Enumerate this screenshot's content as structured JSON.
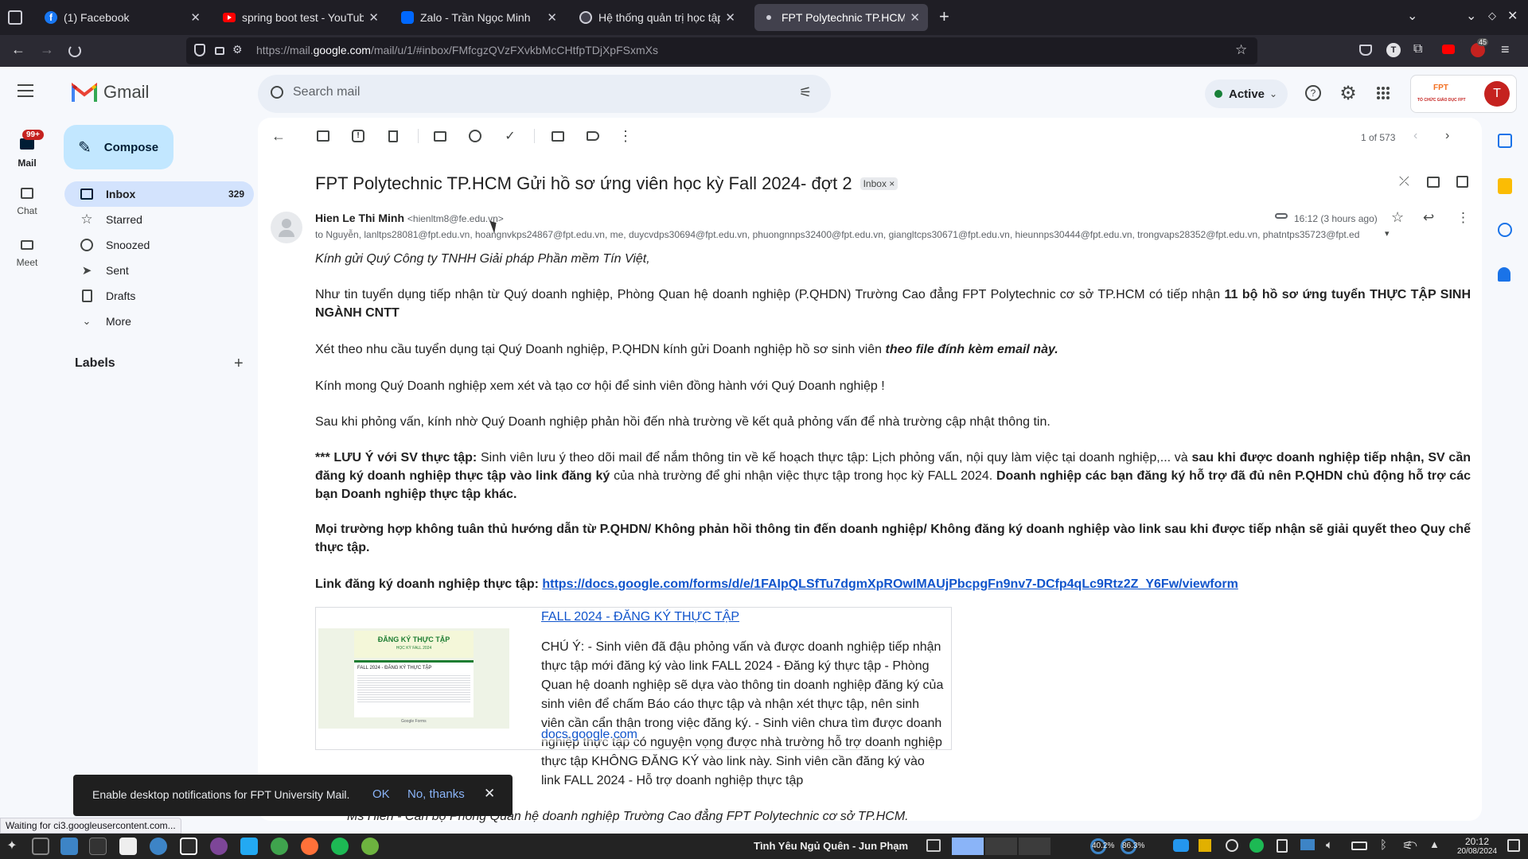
{
  "browser": {
    "tabs": [
      {
        "title": "(1) Facebook",
        "icon": "facebook-icon",
        "color": "#1877f2"
      },
      {
        "title": "spring boot test - YouTube",
        "icon": "youtube-icon",
        "color": "#ff0000"
      },
      {
        "title": "Zalo - Trần Ngọc Minh",
        "icon": "zalo-icon",
        "color": "#0068ff"
      },
      {
        "title": "Hệ thống quản trị học tập",
        "icon": "lms-icon",
        "color": "#f37021"
      },
      {
        "title": "FPT Polytechnic TP.HCM Gửi",
        "icon": "gmail-icon",
        "color": "#ea4335"
      }
    ],
    "url_prefix": "https://mail.",
    "url_domain": "google.com",
    "url_rest": "/mail/u/1/#inbox/FMfcgzQVzFXvkbMcCHtfpTDjXpFSxmXs",
    "ext_badge": "45"
  },
  "gmail": {
    "logo_text": "Gmail",
    "search_placeholder": "Search mail",
    "status_label": "Active",
    "account_initial": "T",
    "org_logo_text": "TỔ CHỨC GIÁO DỤC FPT",
    "rail": [
      {
        "label": "Mail",
        "badge": "99+"
      },
      {
        "label": "Chat"
      },
      {
        "label": "Meet"
      }
    ],
    "compose_label": "Compose",
    "nav": [
      {
        "label": "Inbox",
        "count": "329"
      },
      {
        "label": "Starred"
      },
      {
        "label": "Snoozed"
      },
      {
        "label": "Sent"
      },
      {
        "label": "Drafts"
      },
      {
        "label": "More"
      }
    ],
    "labels_heading": "Labels",
    "pagination": "1 of 573"
  },
  "email": {
    "subject": "FPT Polytechnic TP.HCM Gửi hồ sơ ứng viên học kỳ Fall 2024- đợt 2",
    "inbox_chip": "Inbox",
    "sender_name": "Hien Le Thi Minh",
    "sender_email": "<hienltm8@fe.edu.vn>",
    "time": "16:12 (3 hours ago)",
    "recipients": "to Nguyễn, lanltps28081@fpt.edu.vn, hoangnvkps24867@fpt.edu.vn, me, duycvdps30694@fpt.edu.vn, phuongnnps32400@fpt.edu.vn, giangltcps30671@fpt.edu.vn, hieunnps30444@fpt.edu.vn, trongvaps28352@fpt.edu.vn, phatntps35723@fpt.ed",
    "greeting": "Kính gửi Quý Công ty TNHH Giải pháp Phần mềm Tín Việt,",
    "p1_text": "Như tin tuyển dụng tiếp nhận từ Quý doanh nghiệp, Phòng Quan hệ doanh nghiệp (P.QHDN) Trường Cao đẳng FPT Polytechnic cơ sở TP.HCM có tiếp nhận ",
    "p1_bold": "11 bộ hồ sơ ứng tuyển THỰC TẬP SINH NGÀNH CNTT",
    "p2_text": "Xét theo nhu cầu tuyển dụng tại Quý Doanh nghiệp, P.QHDN kính gửi Doanh nghiệp hồ sơ sinh viên ",
    "p2_bold_italic": "theo file đính kèm email này.",
    "p3": "Kính mong Quý Doanh nghiệp xem xét và tạo cơ hội để sinh viên đồng hành với Quý Doanh nghiệp !",
    "p4": "Sau khi phỏng vấn, kính nhờ Quý Doanh nghiệp phản hồi đến nhà trường về kết quả phỏng vấn để nhà trường cập nhật thông tin.",
    "note_label": "*** LƯU Ý với SV thực tập:",
    "note_text1": " Sinh viên lưu ý theo dõi mail để nắm thông tin về kế hoạch thực tập: Lịch phỏng vấn, nội quy làm việc tại doanh nghiệp,... và ",
    "note_bold1": "sau khi được doanh nghiệp tiếp nhận, SV cần đăng ký doanh nghiệp thực tập vào link đăng ký",
    "note_text2": " của nhà trường để ghi nhận việc thực tập trong học kỳ FALL 2024.  ",
    "note_bold2": "Doanh nghiệp các bạn đăng ký hỗ trợ đã đủ nên P.QHDN chủ động hỗ trợ các bạn Doanh nghiệp thực tập khác.",
    "p6": "Mọi trường hợp không tuân thủ hướng dẫn từ P.QHDN/ Không phản hồi thông tin đến doanh nghiệp/ Không đăng ký doanh nghiệp vào link sau khi được tiếp nhận sẽ giải quyết theo Quy chế thực tập.",
    "link_label": "Link đăng ký doanh nghiệp thực tập: ",
    "link_url": "https://docs.google.com/forms/d/e/1FAIpQLSfTu7dgmXpROwIMAUjPbcpgFn9nv7-DCfp4qLc9Rtz2Z_Y6Fw/viewform",
    "card": {
      "title": "FALL 2024 - ĐĂNG KÝ THỰC TẬP",
      "description": "CHÚ Ý: - Sinh viên đã đậu phỏng vấn và được doanh nghiệp tiếp nhận thực tập mới đăng ký vào link FALL 2024 - Đăng ký thực tập - Phòng Quan hệ doanh nghiệp sẽ dựa vào thông tin doanh nghiệp đăng ký của sinh viên để chấm Báo cáo thực tập và nhận xét thực tập, nên sinh viên cần cẩn thận trong việc đăng ký. - Sinh viên chưa tìm được doanh nghiệp thực tập có nguyện vọng được nhà trường hỗ trợ doanh nghiệp thực tập KHÔNG ĐĂNG KÝ vào link này. Sinh viên cần đăng ký vào link FALL 2024 - Hỗ trợ doanh nghiệp thực tập",
      "domain": "docs.google.com",
      "thumb_title": "ĐĂNG KÝ THỰC TẬP",
      "thumb_sub": "HỌC KỲ FALL 2024",
      "thumb_form_title": "FALL 2024 - ĐĂNG KÝ THỰC TẬP",
      "thumb_footer": "Google Forms"
    },
    "signature": "Ms Hiền - Cán bộ Phòng Quan hệ doanh nghiệp Trường Cao đẳng FPT Polytechnic cơ sở TP.HCM."
  },
  "snackbar": {
    "text": "Enable desktop notifications for FPT University Mail.",
    "ok": "OK",
    "no": "No, thanks"
  },
  "status_bar": "Waiting for ci3.googleusercontent.com...",
  "taskbar": {
    "now_playing": "Tình Yêu Ngủ Quên - Jun Phạm",
    "cpu": "40.2%",
    "mem": "86.3%",
    "time": "20:12",
    "date": "20/08/2024"
  }
}
